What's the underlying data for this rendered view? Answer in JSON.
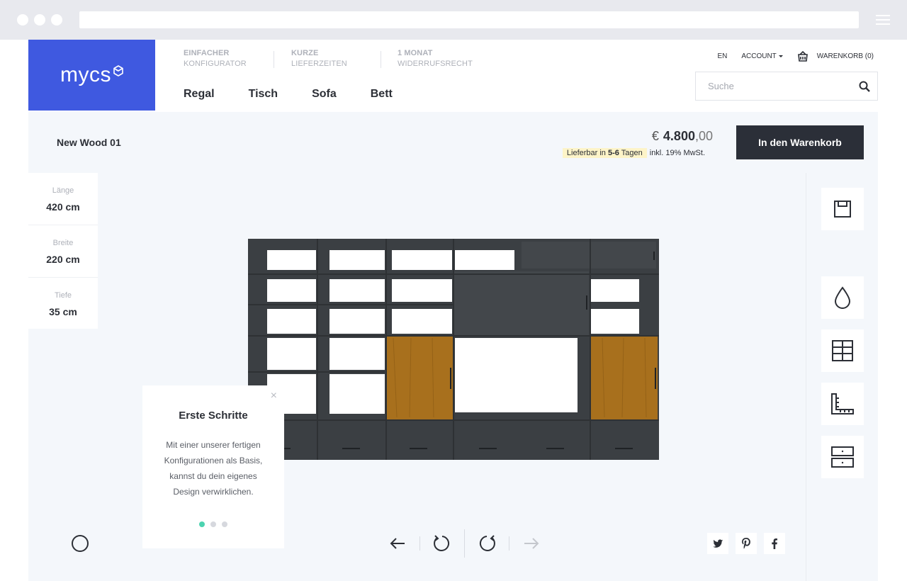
{
  "header": {
    "logo_text": "mycs",
    "usps": [
      {
        "line1": "EINFACHER",
        "line2": "KONFIGURATOR"
      },
      {
        "line1": "KURZE",
        "line2": "LIEFERZEITEN"
      },
      {
        "line1": "1 MONAT",
        "line2": "WIDERRUFSRECHT"
      }
    ],
    "nav": [
      "Regal",
      "Tisch",
      "Sofa",
      "Bett"
    ],
    "language": "EN",
    "account": "ACCOUNT",
    "cart": "WARENKORB (0)",
    "search_placeholder": "Suche"
  },
  "product": {
    "name": "New Wood 01",
    "currency": "€",
    "price_main": "4.800",
    "price_cents": ",00",
    "delivery_prefix": "Lieferbar in",
    "delivery_days": "5-6",
    "delivery_suffix": "Tagen",
    "vat": "inkl. 19% MwSt.",
    "cart_button": "In den Warenkorb"
  },
  "dimensions": [
    {
      "label": "Länge",
      "value": "420 cm"
    },
    {
      "label": "Breite",
      "value": "220 cm"
    },
    {
      "label": "Tiefe",
      "value": "35 cm"
    }
  ],
  "tooltip": {
    "title": "Erste Schritte",
    "body": "Mit einer unserer fertigen Konfigurationen als Basis, kannst du dein eigenes Design verwirklichen.",
    "close": "×",
    "active_step": 1,
    "total_steps": 3
  },
  "tools": [
    "save-icon",
    "color-drop-icon",
    "grid-icon",
    "ruler-icon",
    "drawer-icon"
  ],
  "share": [
    "twitter-icon",
    "pinterest-icon",
    "facebook-icon"
  ],
  "colors": {
    "brand": "#3f59e0",
    "dark": "#2b2f38",
    "shelf": "#3b3f43",
    "wood": "#a8701d",
    "accent": "#4cd3b0"
  }
}
